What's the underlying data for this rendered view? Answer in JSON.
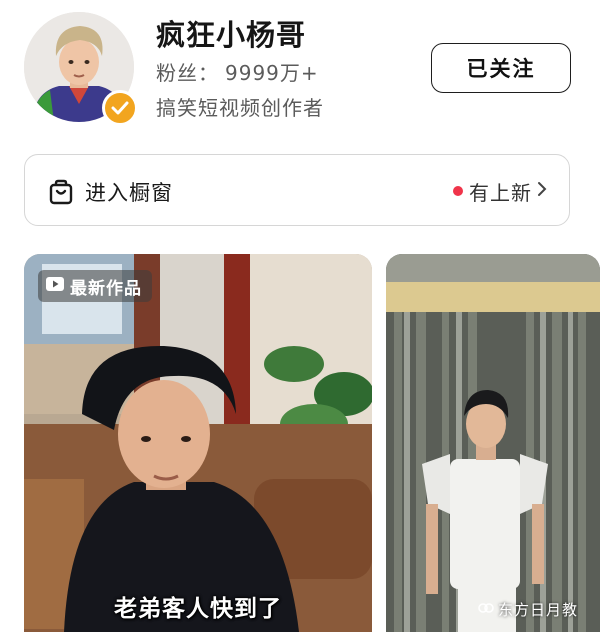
{
  "profile": {
    "name": "疯狂小杨哥",
    "fans_label": "粉丝：",
    "fans_count": "9999万+",
    "bio": "搞笑短视频创作者",
    "follow_button_label": "已关注",
    "verified_icon": "verified-check-icon"
  },
  "shop_window": {
    "label": "进入橱窗",
    "new_label": "有上新",
    "icon": "shopping-bag-icon",
    "dot_color": "#f0344a"
  },
  "videos": [
    {
      "tag_label": "最新作品",
      "tag_icon": "video-play-icon",
      "caption": "老弟客人快到了"
    },
    {
      "caption": ""
    }
  ],
  "watermark": {
    "text": "东方日月教"
  },
  "colors": {
    "verified_badge": "#f2a51f",
    "new_dot": "#f0344a",
    "text_primary": "#161616",
    "text_secondary": "#5b5b5b"
  }
}
